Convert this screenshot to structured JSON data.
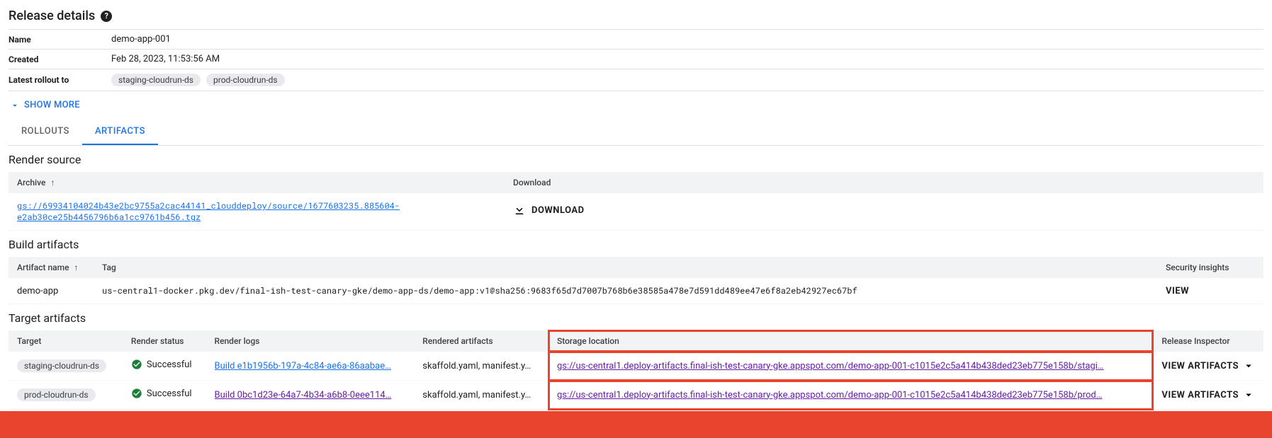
{
  "header": {
    "title": "Release details"
  },
  "details": {
    "name_label": "Name",
    "name_value": "demo-app-001",
    "created_label": "Created",
    "created_value": "Feb 28, 2023, 11:53:56 AM",
    "rollout_label": "Latest rollout to",
    "rollout_targets": [
      "staging-cloudrun-ds",
      "prod-cloudrun-ds"
    ],
    "show_more": "SHOW MORE"
  },
  "tabs": {
    "rollouts": "ROLLOUTS",
    "artifacts": "ARTIFACTS"
  },
  "render_source": {
    "title": "Render source",
    "archive_header": "Archive",
    "download_header": "Download",
    "archive_value": "gs://69934104024b43e2bc9755a2cac44141_clouddeploy/source/1677603235.885604-e2ab30ce25b4456796b6a1cc9761b456.tgz",
    "download_label": "DOWNLOAD"
  },
  "build_artifacts": {
    "title": "Build artifacts",
    "name_header": "Artifact name",
    "tag_header": "Tag",
    "insights_header": "Security insights",
    "rows": [
      {
        "name": "demo-app",
        "tag": "us-central1-docker.pkg.dev/final-ish-test-canary-gke/demo-app-ds/demo-app:v1@sha256:9683f65d7d7007b768b6e38585a478e7d591dd489ee47e6f8a2eb42927ec67bf",
        "insights": "VIEW"
      }
    ]
  },
  "target_artifacts": {
    "title": "Target artifacts",
    "headers": {
      "target": "Target",
      "render_status": "Render status",
      "render_logs": "Render logs",
      "rendered_artifacts": "Rendered artifacts",
      "storage_location": "Storage location",
      "release_inspector": "Release Inspector"
    },
    "rows": [
      {
        "target": "staging-cloudrun-ds",
        "status": "Successful",
        "logs": "Build e1b1956b-197a-4c84-ae6a-86aabae…",
        "rendered": "skaffold.yaml, manifest.y…",
        "storage": "gs://us-central1.deploy-artifacts.final-ish-test-canary-gke.appspot.com/demo-app-001-c1015e2c5a414b438ded23eb775e158b/stagi…",
        "inspector": "VIEW ARTIFACTS"
      },
      {
        "target": "prod-cloudrun-ds",
        "status": "Successful",
        "logs": "Build 0bc1d23e-64a7-4b34-a6b8-0eee114…",
        "rendered": "skaffold.yaml, manifest.y…",
        "storage": "gs://us-central1.deploy-artifacts.final-ish-test-canary-gke.appspot.com/demo-app-001-c1015e2c5a414b438ded23eb775e158b/prod…",
        "inspector": "VIEW ARTIFACTS"
      }
    ]
  }
}
